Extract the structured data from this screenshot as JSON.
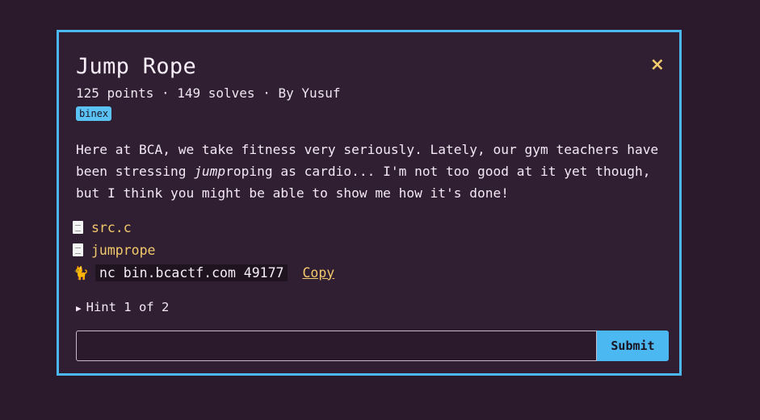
{
  "challenge": {
    "title": "Jump Rope",
    "meta": "125 points · 149 solves · By Yusuf",
    "tag": "binex",
    "description": {
      "before": "Here at BCA, we take fitness very seriously. Lately, our gym teachers have been stressing ",
      "emphasis": "jump",
      "after": "roping as cardio... I'm not too good at it yet though, but I think you might be able to show me how it's done!"
    },
    "files": [
      {
        "name": "src.c",
        "icon": "document-icon"
      },
      {
        "name": "jumprope",
        "icon": "document-icon"
      }
    ],
    "connection": {
      "icon": "cat-icon",
      "command": "nc bin.bcactf.com 49177",
      "copy_label": "Copy"
    },
    "hint_label": "Hint 1 of 2",
    "flag_input": {
      "value": "",
      "placeholder": ""
    },
    "submit_label": "Submit",
    "close_symbol": "×"
  },
  "colors": {
    "background": "#2a1a2c",
    "modal": "#301f33",
    "accent_blue": "#4cb8f2",
    "link_gold": "#f2c96b"
  }
}
